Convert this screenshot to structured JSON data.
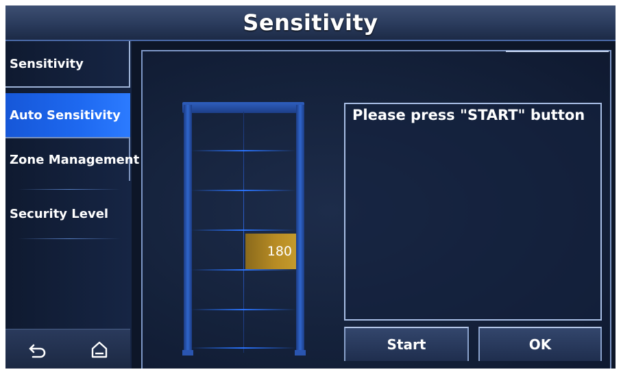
{
  "header": {
    "title": "Sensitivity"
  },
  "sidebar": {
    "items": [
      {
        "label": "Sensitivity"
      },
      {
        "label": "Auto Sensitivity"
      },
      {
        "label": "Zone Management"
      },
      {
        "label": "Security Level"
      }
    ],
    "active_index": 1
  },
  "bottom_nav": {
    "back_icon": "back-arrow-icon",
    "home_icon": "home-icon"
  },
  "gate": {
    "level_value": "180"
  },
  "message": {
    "text": "Please press \"START\" button"
  },
  "buttons": {
    "start_label": "Start",
    "ok_label": "OK"
  },
  "colors": {
    "active_tab": "#1e69f0",
    "level_bar": "#b88c24",
    "gate_blue": "#2a74ff",
    "border": "#a9bfe6"
  }
}
